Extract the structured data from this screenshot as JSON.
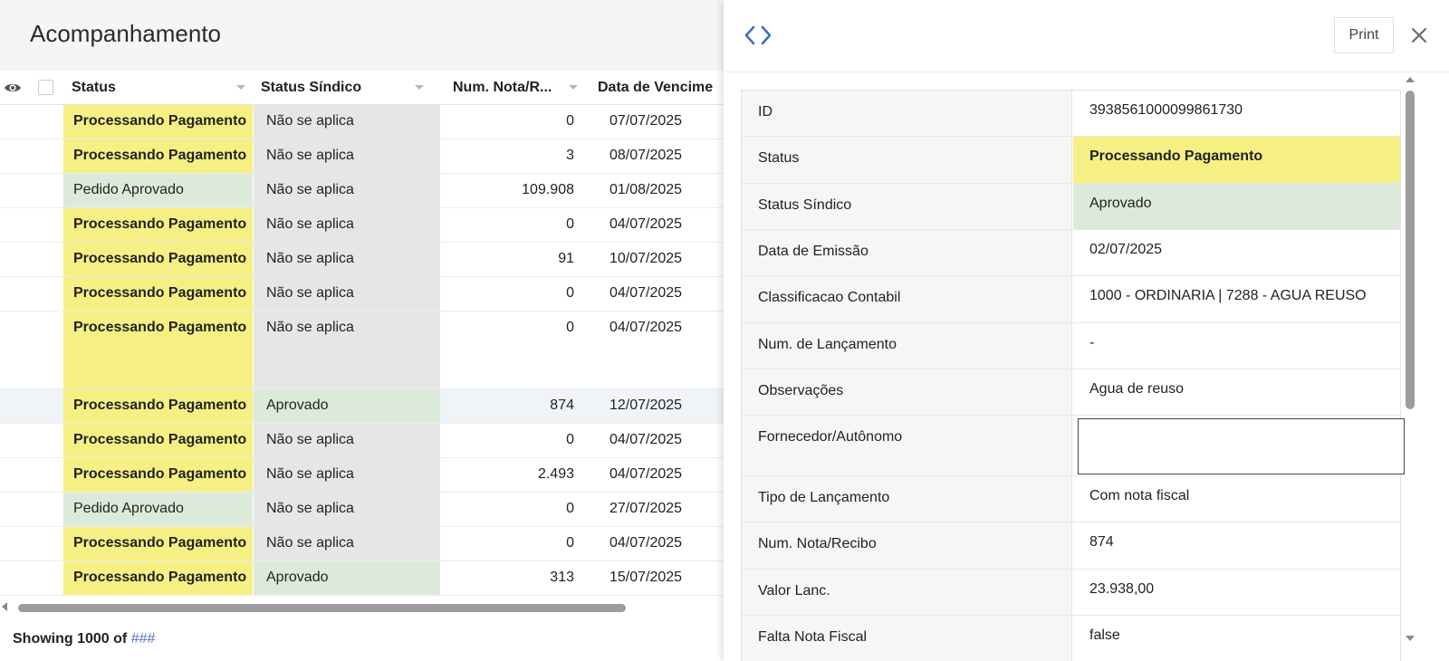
{
  "page": {
    "title": "Acompanhamento"
  },
  "grid": {
    "columns": [
      {
        "label": "Status"
      },
      {
        "label": "Status Síndico"
      },
      {
        "label": "Num. Nota/R..."
      },
      {
        "label": "Data de Vencime"
      }
    ],
    "rows": [
      {
        "status": "Processando Pagamento",
        "status_sindico": "Não se aplica",
        "num": "0",
        "date": "07/07/2025"
      },
      {
        "status": "Processando Pagamento",
        "status_sindico": "Não se aplica",
        "num": "3",
        "date": "08/07/2025"
      },
      {
        "status": "Pedido Aprovado",
        "status_sindico": "Não se aplica",
        "num": "109.908",
        "date": "01/08/2025"
      },
      {
        "status": "Processando Pagamento",
        "status_sindico": "Não se aplica",
        "num": "0",
        "date": "04/07/2025"
      },
      {
        "status": "Processando Pagamento",
        "status_sindico": "Não se aplica",
        "num": "91",
        "date": "10/07/2025"
      },
      {
        "status": "Processando Pagamento",
        "status_sindico": "Não se aplica",
        "num": "0",
        "date": "04/07/2025"
      },
      {
        "status": "Processando Pagamento",
        "status_sindico": "Não se aplica",
        "num": "0",
        "date": "04/07/2025"
      },
      {
        "status": "Processando Pagamento",
        "status_sindico": "Aprovado",
        "num": "874",
        "date": "12/07/2025"
      },
      {
        "status": "Processando Pagamento",
        "status_sindico": "Não se aplica",
        "num": "0",
        "date": "04/07/2025"
      },
      {
        "status": "Processando Pagamento",
        "status_sindico": "Não se aplica",
        "num": "2.493",
        "date": "04/07/2025"
      },
      {
        "status": "Pedido Aprovado",
        "status_sindico": "Não se aplica",
        "num": "0",
        "date": "27/07/2025"
      },
      {
        "status": "Processando Pagamento",
        "status_sindico": "Não se aplica",
        "num": "0",
        "date": "04/07/2025"
      },
      {
        "status": "Processando Pagamento",
        "status_sindico": "Aprovado",
        "num": "313",
        "date": "15/07/2025"
      }
    ]
  },
  "footer": {
    "showing_label": "Showing 1000 of",
    "total": "###"
  },
  "detail": {
    "print_label": "Print",
    "fields": [
      {
        "label": "ID",
        "value": "3938561000099861730"
      },
      {
        "label": "Status",
        "value": "Processando Pagamento"
      },
      {
        "label": "Status Síndico",
        "value": "Aprovado"
      },
      {
        "label": "Data de Emissão",
        "value": "02/07/2025"
      },
      {
        "label": "Classificacao Contabil",
        "value": "1000 - ORDINARIA | 7288 - AGUA REUSO"
      },
      {
        "label": "Num. de Lançamento",
        "value": "-"
      },
      {
        "label": "Observações",
        "value": "Agua de reuso"
      },
      {
        "label": "Fornecedor/Autônomo",
        "value": ""
      },
      {
        "label": "Tipo de Lançamento",
        "value": "Com nota fiscal"
      },
      {
        "label": "Num. Nota/Recibo",
        "value": "874"
      },
      {
        "label": "Valor Lanc.",
        "value": "23.938,00"
      },
      {
        "label": "Falta Nota Fiscal",
        "value": "false"
      }
    ]
  },
  "colors": {
    "status_processing": "#f6f084",
    "status_approved": "#dcebd9",
    "status_not_applicable": "#e6e6e6",
    "link": "#4a78c8"
  },
  "icons": {
    "visibility": "eye-icon",
    "code": "code-icon",
    "close": "close-icon"
  }
}
